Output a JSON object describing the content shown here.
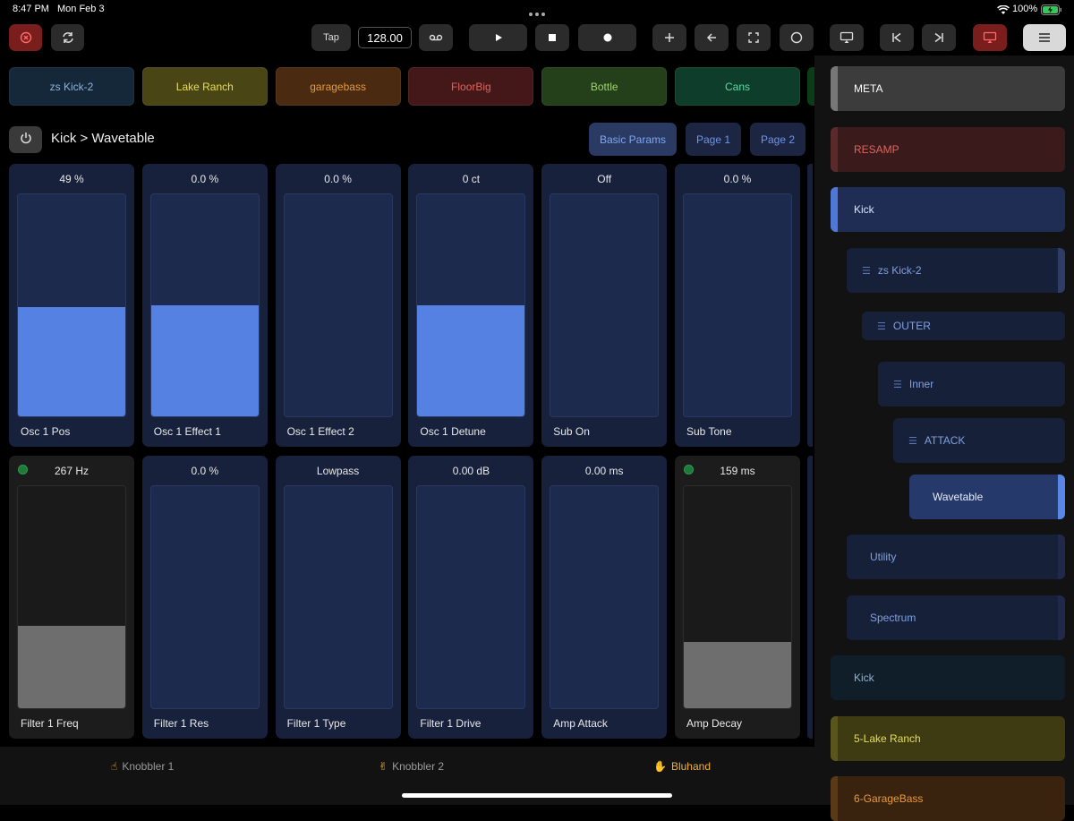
{
  "status_bar": {
    "time": "8:47 PM",
    "date": "Mon Feb 3",
    "battery": "100%"
  },
  "toolbar": {
    "tap_label": "Tap",
    "bpm": "128.00"
  },
  "clips": [
    {
      "label": "zs Kick-2",
      "bg": "#14283a",
      "fg": "#8fb3d6"
    },
    {
      "label": "Lake Ranch",
      "bg": "#4a4514",
      "fg": "#e7de53"
    },
    {
      "label": "garagebass",
      "bg": "#4a2a10",
      "fg": "#e69a3a"
    },
    {
      "label": "FloorBig",
      "bg": "#441818",
      "fg": "#e0645c"
    },
    {
      "label": "Bottle",
      "bg": "#23401a",
      "fg": "#9fd46a"
    },
    {
      "label": "Cans",
      "bg": "#0f3d2c",
      "fg": "#57dca0"
    }
  ],
  "device": {
    "title": "Kick > Wavetable",
    "pages": [
      "Basic Params",
      "Page 1",
      "Page 2"
    ]
  },
  "params_row1": [
    {
      "label": "Osc 1 Pos",
      "value": "49 %",
      "fill_pct": 49
    },
    {
      "label": "Osc 1 Effect 1",
      "value": "0.0 %",
      "fill_pct": 50
    },
    {
      "label": "Osc 1 Effect 2",
      "value": "0.0 %",
      "fill_pct": 0
    },
    {
      "label": "Osc 1 Detune",
      "value": "0 ct",
      "fill_pct": 50
    },
    {
      "label": "Sub On",
      "value": "Off",
      "fill_pct": 0
    },
    {
      "label": "Sub Tone",
      "value": "0.0 %",
      "fill_pct": 0
    }
  ],
  "params_row2": [
    {
      "label": "Filter 1 Freq",
      "value": "267 Hz",
      "fill_pct": 37,
      "led": true
    },
    {
      "label": "Filter 1 Res",
      "value": "0.0 %",
      "fill_pct": 0
    },
    {
      "label": "Filter 1 Type",
      "value": "Lowpass",
      "fill_pct": 0
    },
    {
      "label": "Filter 1 Drive",
      "value": "0.00 dB",
      "fill_pct": 0
    },
    {
      "label": "Amp Attack",
      "value": "0.00 ms",
      "fill_pct": 0
    },
    {
      "label": "Amp Decay",
      "value": "159 ms",
      "fill_pct": 30,
      "led": true
    }
  ],
  "bottom_tabs": [
    {
      "icon": "☝",
      "label": "Knobbler 1"
    },
    {
      "icon": "✌",
      "label": "Knobbler 2"
    },
    {
      "icon": "✋",
      "label": "Bluhand"
    }
  ],
  "tree": [
    {
      "label": "META",
      "bg": "#3c3c3c",
      "fg": "#ffffff",
      "bar": "#777777"
    },
    {
      "label": "RESAMP",
      "bg": "#3a1a1a",
      "fg": "#e0645c",
      "bar": "#5a2a2a"
    },
    {
      "label": "Kick",
      "bg": "#1f2d55",
      "fg": "#dfe6f6",
      "bar": "#4f78d6"
    },
    {
      "label": "zs Kick-2",
      "bg": "#172039",
      "fg": "#7fa0e0",
      "rbar": "#2e3c66",
      "list": true
    },
    {
      "label": "OUTER",
      "bg": "#172039",
      "fg": "#7fa0e0",
      "list": true
    },
    {
      "label": "Inner",
      "bg": "#172039",
      "fg": "#7fa0e0",
      "list": true
    },
    {
      "label": "ATTACK",
      "bg": "#172039",
      "fg": "#7fa0e0",
      "list": true
    },
    {
      "label": "Wavetable",
      "bg": "#25396a",
      "fg": "#e6ecfa",
      "rbar": "#5a86e8"
    },
    {
      "label": "Utility",
      "bg": "#172039",
      "fg": "#7fa0e0",
      "rbar": "#1f2a4a"
    },
    {
      "label": "Spectrum",
      "bg": "#172039",
      "fg": "#7fa0e0",
      "rbar": "#1f2a4a"
    },
    {
      "label": "Kick",
      "bg": "#0f1e29",
      "fg": "#8fb3d6"
    },
    {
      "label": "5-Lake Ranch",
      "bg": "#3e3a12",
      "fg": "#e7de53",
      "bar": "#5a551a"
    },
    {
      "label": "6-GarageBass",
      "bg": "#3a230e",
      "fg": "#e69a3a",
      "bar": "#5a3a16"
    }
  ]
}
